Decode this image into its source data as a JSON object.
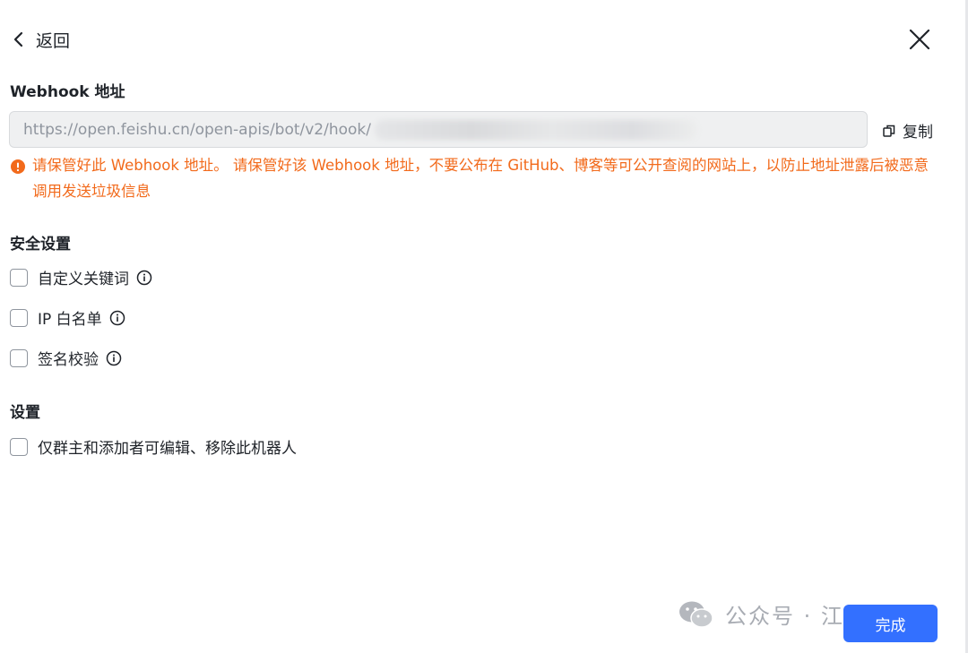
{
  "header": {
    "back_label": "返回"
  },
  "webhook": {
    "label": "Webhook 地址",
    "url": "https://open.feishu.cn/open-apis/bot/v2/hook/",
    "copy_label": "复制",
    "warning": "请保管好此 Webhook 地址。 请保管好该 Webhook 地址，不要公布在 GitHub、博客等可公开查阅的网站上，以防止地址泄露后被恶意调用发送垃圾信息"
  },
  "security": {
    "label": "安全设置",
    "options": [
      {
        "label": "自定义关键词",
        "checked": false
      },
      {
        "label": "IP 白名单",
        "checked": false
      },
      {
        "label": "签名校验",
        "checked": false
      }
    ]
  },
  "settings": {
    "label": "设置",
    "options": [
      {
        "label": "仅群主和添加者可编辑、移除此机器人",
        "checked": false
      }
    ]
  },
  "footer": {
    "done_label": "完成"
  },
  "watermark": {
    "text": "公众号 · 江达小记"
  },
  "colors": {
    "accent": "#3370ff",
    "warning": "#f26a1b",
    "text": "#1f2329",
    "muted": "#8f959e"
  },
  "icons": [
    "chevron-left-icon",
    "close-icon",
    "copy-icon",
    "warning-icon",
    "info-icon",
    "wechat-icon"
  ]
}
